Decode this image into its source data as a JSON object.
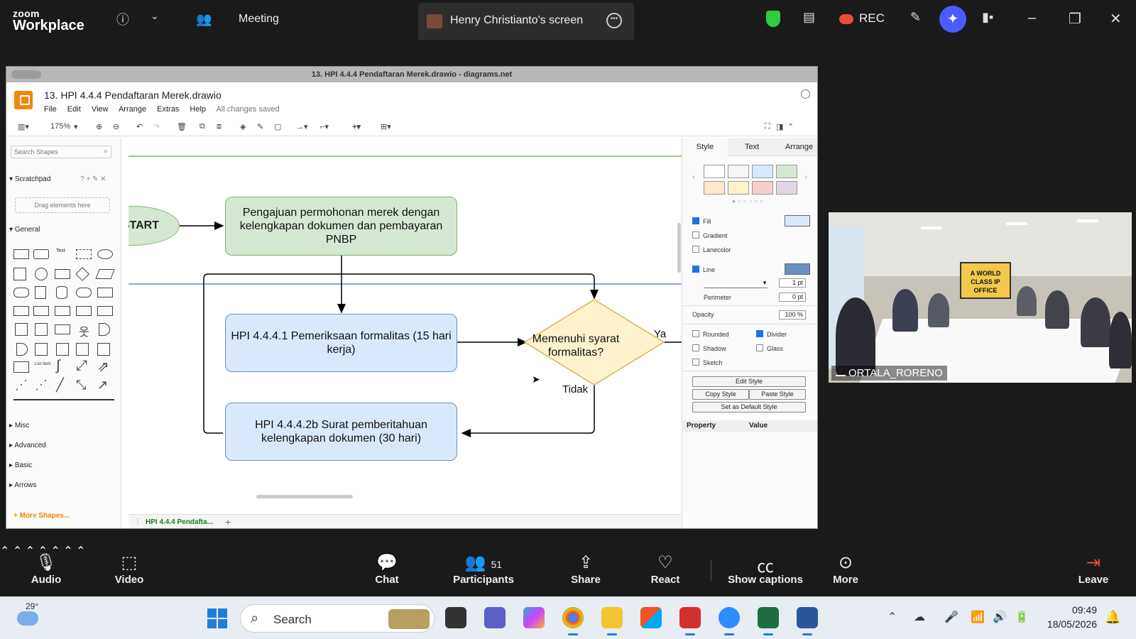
{
  "zoom": {
    "logo_top": "zoom",
    "logo_bottom": "Workplace",
    "meeting_label": "Meeting",
    "share_tab": "Henry Christianto's screen",
    "rec_label": "REC"
  },
  "drawio": {
    "window_title": "13. HPI 4.4.4 Pendaftaran Merek.drawio - diagrams.net",
    "file_title": "13. HPI 4.4.4 Pendaftaran Merek.drawio",
    "menu": [
      "File",
      "Edit",
      "View",
      "Arrange",
      "Extras",
      "Help"
    ],
    "save_status": "All changes saved",
    "zoom_level": "175%",
    "search_placeholder": "Search Shapes",
    "scratchpad": "Scratchpad",
    "drag_here": "Drag elements here",
    "sections": [
      "General",
      "Misc",
      "Advanced",
      "Basic",
      "Arrows"
    ],
    "shape_text": "Text",
    "more_shapes": "+ More Shapes...",
    "page_tab": "HPI 4.4.4 Pendafta...",
    "format_tabs": [
      "Style",
      "Text",
      "Arrange"
    ],
    "swatch_colors": [
      "#ffffff",
      "#f5f5f5",
      "#dae8fc",
      "#d5e8d4",
      "#ffe6cc",
      "#fff2cc",
      "#f8cecc",
      "#e1d5e7"
    ],
    "fill_label": "Fill",
    "gradient_label": "Gradient",
    "lanecolor_label": "Lanecolor",
    "line_label": "Line",
    "line_width": "1 pt",
    "perimeter_label": "Perimeter",
    "perimeter_value": "0 pt",
    "opacity_label": "Opacity",
    "opacity_value": "100 %",
    "rounded_label": "Rounded",
    "divider_label": "Divider",
    "shadow_label": "Shadow",
    "glass_label": "Glass",
    "sketch_label": "Sketch",
    "edit_style": "Edit Style",
    "copy_style": "Copy Style",
    "paste_style": "Paste Style",
    "default_style": "Set as Default Style",
    "property_header": "Property",
    "value_header": "Value"
  },
  "diagram": {
    "start": "START",
    "step1": "Pengajuan permohonan merek dengan kelengkapan dokumen dan pembayaran PNBP",
    "step2": "HPI 4.4.4.1 Pemeriksaan formalitas (15 hari kerja)",
    "decision": "Memenuhi syarat formalitas?",
    "yes_label": "Ya",
    "no_label": "Tidak",
    "step3": "HPI 4.4.4.2b Surat pemberitahuan kelengkapan dokumen (30 hari)"
  },
  "video": {
    "participant_name": "ORTALA_RORENO",
    "banner_text": "A WORLD CLASS IP OFFICE"
  },
  "toolbar": {
    "audio": "Audio",
    "video": "Video",
    "chat": "Chat",
    "participants": "Participants",
    "participants_count": "51",
    "share": "Share",
    "react": "React",
    "captions": "Show captions",
    "more": "More",
    "leave": "Leave"
  },
  "taskbar": {
    "temperature": "29°",
    "search": "Search",
    "time": "09:49",
    "date": "18/05/2026"
  },
  "colors": {
    "zoom_bg": "#1a1a1a",
    "green_fill": "#d5e8d4",
    "blue_fill": "#dae8fc",
    "decision_fill": "#fff2cc",
    "accent": "#4a5cff",
    "leave_red": "#e74c3c"
  }
}
